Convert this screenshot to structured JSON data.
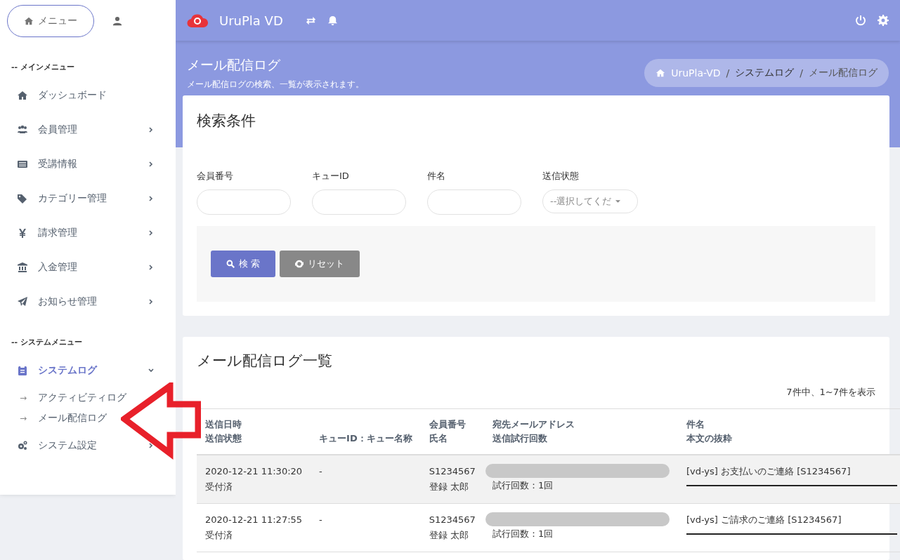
{
  "sidebar": {
    "menu_button": "メニュー",
    "sections": [
      {
        "title": "-- メインメニュー",
        "items": [
          {
            "label": "ダッシュボード",
            "selected": false
          },
          {
            "label": "会員管理",
            "selected": false,
            "expanded": false
          },
          {
            "label": "受講情報",
            "selected": false,
            "expanded": false
          },
          {
            "label": "カテゴリー管理",
            "selected": false,
            "expanded": false
          },
          {
            "label": "請求管理",
            "selected": false,
            "expanded": false
          },
          {
            "label": "入金管理",
            "selected": false,
            "expanded": false
          },
          {
            "label": "お知らせ管理",
            "selected": false,
            "expanded": false
          }
        ]
      },
      {
        "title": "-- システムメニュー",
        "items": [
          {
            "label": "システムログ",
            "selected": true,
            "expanded": true,
            "children": [
              {
                "arrow": "→",
                "label": "アクティビティログ"
              },
              {
                "arrow": "→",
                "label": "メール配信ログ"
              }
            ]
          },
          {
            "label": "システム設定",
            "selected": false,
            "expanded": false
          }
        ]
      }
    ]
  },
  "topbar": {
    "brand": "UruPla VD"
  },
  "page_header": {
    "title": "メール配信ログ",
    "subtitle": "メール配信ログの検索、一覧が表示されます。",
    "breadcrumb": [
      "UruPla-VD",
      "システムログ",
      "メール配信ログ"
    ],
    "breadcrumb_separator": "/"
  },
  "search_card": {
    "title": "検索条件",
    "fields": [
      {
        "label": "会員番号",
        "kind": "text"
      },
      {
        "label": "キューID",
        "kind": "text"
      },
      {
        "label": "件名",
        "kind": "text"
      },
      {
        "label": "送信状態",
        "kind": "select",
        "value": "--選択してくだ"
      }
    ],
    "buttons": [
      {
        "label": "検 索",
        "kind": "primary"
      },
      {
        "label": "リセット",
        "kind": "secondary"
      }
    ]
  },
  "list_card": {
    "title": "メール配信ログ一覧",
    "summary": "7件中、1~7件を表示",
    "columns": [
      [
        "送信日時",
        "送信状態"
      ],
      [
        "キューID：キュー名称"
      ],
      [
        "会員番号",
        "氏名"
      ],
      [
        "宛先メールアドレス",
        "送信試行回数"
      ],
      [
        "件名",
        "本文の抜粋"
      ]
    ],
    "rows": [
      {
        "datetime": "2020-12-21 11:30:20",
        "status": "受付済",
        "queue": "-",
        "member_no": "S1234567",
        "name": "登録 太郎",
        "attempts": "試行回数：1回",
        "subject": "[vd-ys] お支払いのご連絡 [S1234567]"
      },
      {
        "datetime": "2020-12-21 11:27:55",
        "status": "受付済",
        "queue": "-",
        "member_no": "S1234567",
        "name": "登録 太郎",
        "attempts": "試行回数：1回",
        "subject": "[vd-ys] ご請求のご連絡 [S1234567]"
      }
    ]
  }
}
